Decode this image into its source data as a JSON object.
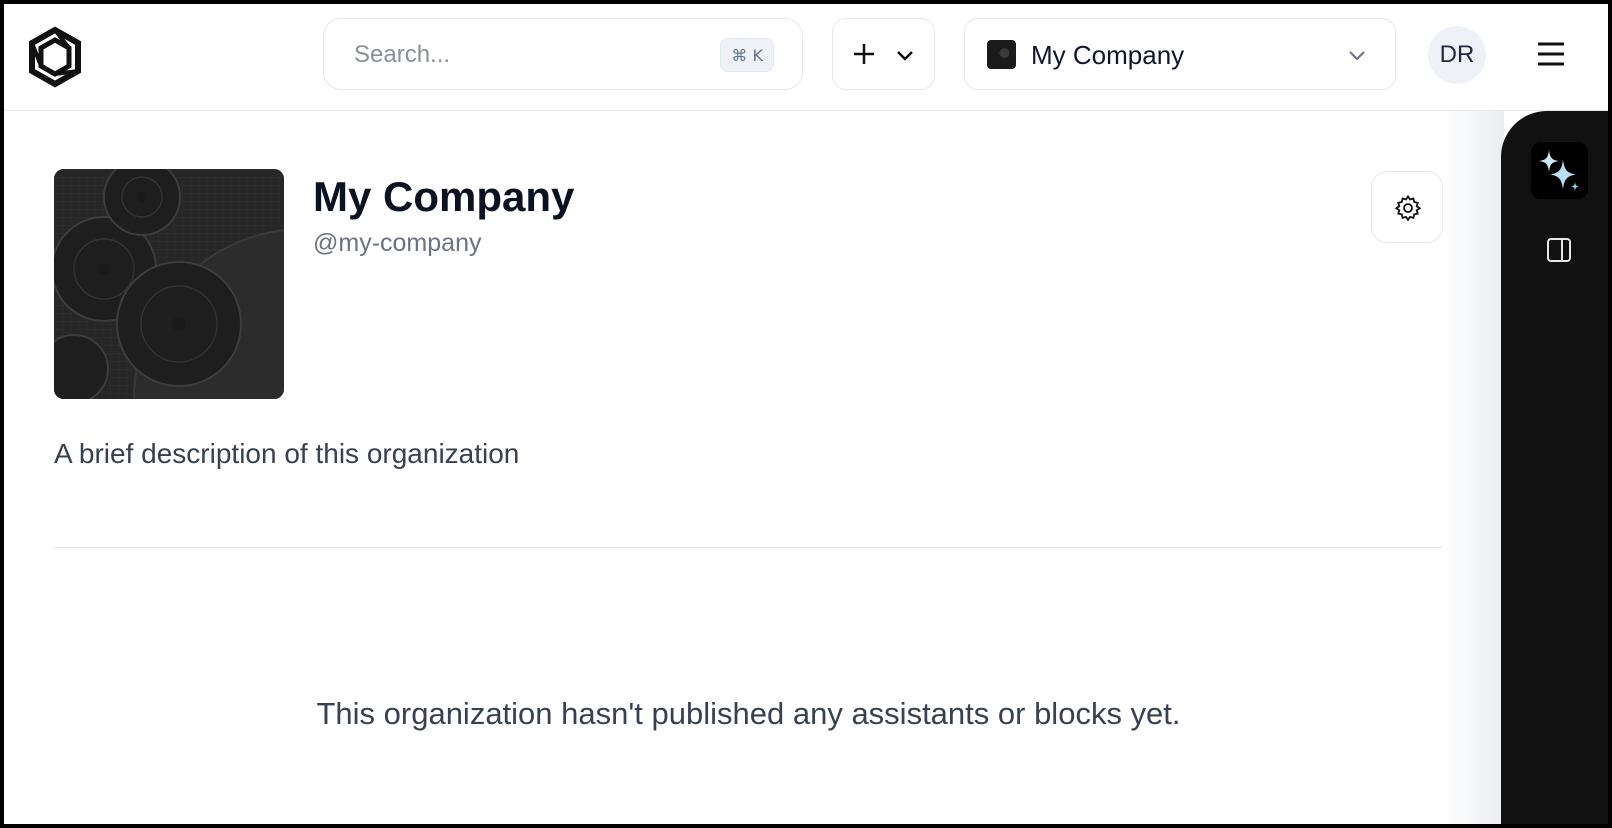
{
  "header": {
    "search": {
      "placeholder": "Search...",
      "shortcut": "⌘ K"
    },
    "add_button": {
      "icon": "plus-icon",
      "dropdown_icon": "chevron-down-icon"
    },
    "org_selector": {
      "name": "My Company",
      "icon": "chevron-down-icon"
    },
    "user": {
      "initials": "DR"
    },
    "menu_icon": "hamburger-menu-icon"
  },
  "org": {
    "name": "My Company",
    "handle": "@my-company",
    "description": "A brief description of this organization",
    "settings_icon": "gear-icon"
  },
  "empty_state": {
    "message": "This organization hasn't published any assistants or blocks yet."
  },
  "rail": {
    "items": [
      "sparkle-icon",
      "sidebar-panel-icon"
    ]
  }
}
